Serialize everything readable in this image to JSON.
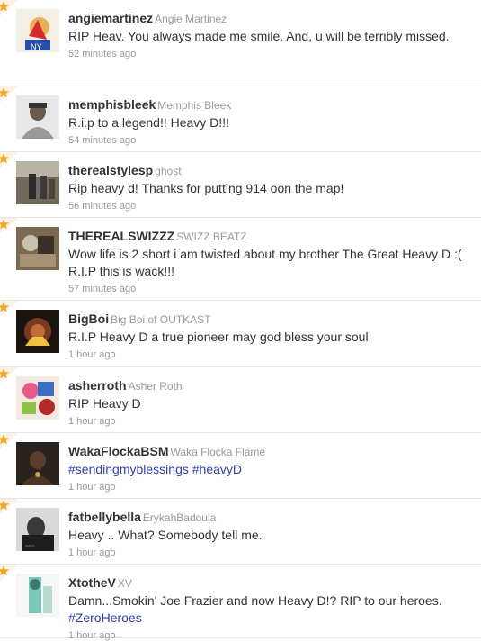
{
  "tweets": [
    {
      "screen_name": "angiemartinez",
      "full_name": "Angie Martinez",
      "segments": [
        {
          "text": "RIP Heav. You always made me smile. And, u will be terribly missed.",
          "link": false
        }
      ],
      "time": "52 minutes ago",
      "avatar": "angiemartinez-avatar"
    },
    {
      "screen_name": "memphisbleek",
      "full_name": "Memphis Bleek",
      "segments": [
        {
          "text": "R.i.p to a legend!! Heavy D!!!",
          "link": false
        }
      ],
      "time": "54 minutes ago",
      "avatar": "memphisbleek-avatar"
    },
    {
      "screen_name": "therealstylesp",
      "full_name": "ghost",
      "segments": [
        {
          "text": "Rip heavy d! Thanks for putting 914 oon the map!",
          "link": false
        }
      ],
      "time": "56 minutes ago",
      "avatar": "therealstylesp-avatar"
    },
    {
      "screen_name": "THEREALSWIZZZ",
      "full_name": "SWIZZ BEATZ",
      "segments": [
        {
          "text": "Wow life is 2 short i am twisted about my brother The Great Heavy D :( R.I.P this is wack!!!",
          "link": false
        }
      ],
      "time": "57 minutes ago",
      "avatar": "therealswizzz-avatar"
    },
    {
      "screen_name": "BigBoi",
      "full_name": "Big Boi of OUTKAST",
      "segments": [
        {
          "text": "R.I.P Heavy D a true pioneer may god bless your soul",
          "link": false
        }
      ],
      "time": "1 hour ago",
      "avatar": "bigboi-avatar"
    },
    {
      "screen_name": "asherroth",
      "full_name": "Asher Roth",
      "segments": [
        {
          "text": "RIP Heavy D",
          "link": false
        }
      ],
      "time": "1 hour ago",
      "avatar": "asherroth-avatar"
    },
    {
      "screen_name": "WakaFlockaBSM",
      "full_name": "Waka Flocka Flame",
      "segments": [
        {
          "text": "#sendingmyblessings",
          "link": true
        },
        {
          "text": " ",
          "link": false
        },
        {
          "text": "#heavyD",
          "link": true
        }
      ],
      "time": "1 hour ago",
      "avatar": "wakaflockabsm-avatar"
    },
    {
      "screen_name": "fatbellybella",
      "full_name": "ErykahBadoula",
      "segments": [
        {
          "text": "Heavy .. What? Somebody tell me.",
          "link": false
        }
      ],
      "time": "1 hour ago",
      "avatar": "fatbellybella-avatar"
    },
    {
      "screen_name": "XtotheV",
      "full_name": "XV",
      "segments": [
        {
          "text": "Damn...Smokin' Joe Frazier and now Heavy D!? RIP to our heroes. ",
          "link": false
        },
        {
          "text": "#ZeroHeroes",
          "link": true
        }
      ],
      "time": "1 hour ago",
      "avatar": "xthev-avatar"
    }
  ]
}
